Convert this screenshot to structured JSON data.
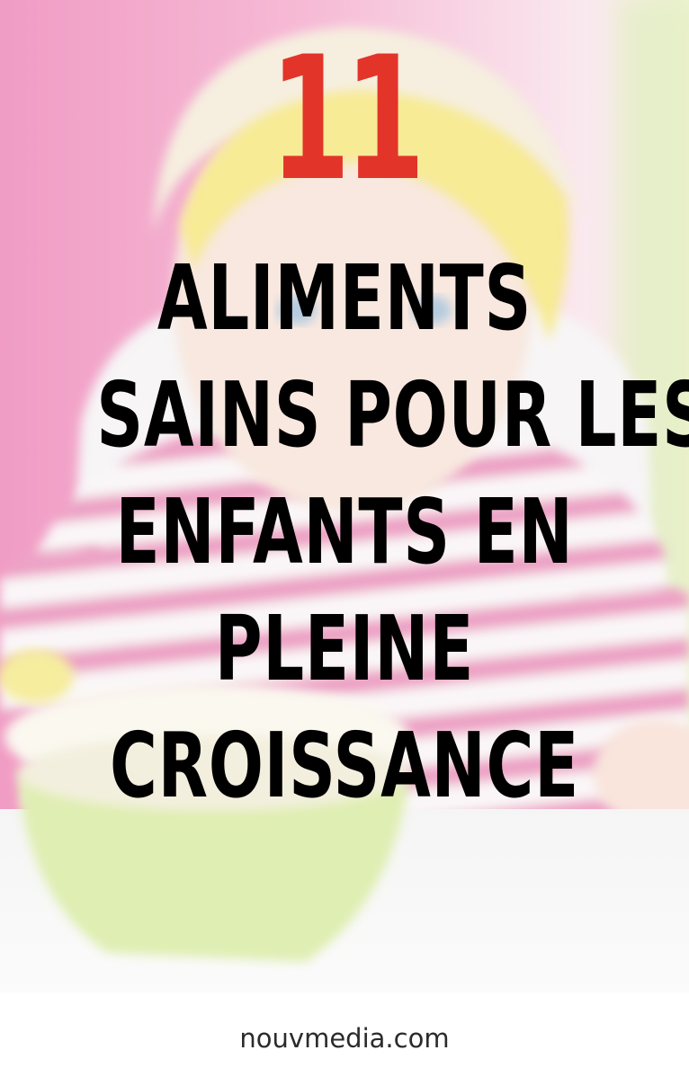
{
  "poster": {
    "number": "11",
    "title_lines": [
      "ALIMENTS",
      "SAINS POUR LES",
      "ENFANTS EN",
      "PLEINE",
      "CROISSANCE"
    ]
  },
  "footer": {
    "site": "nouvmedia.com"
  },
  "colors": {
    "number": "#e3342a",
    "title": "#000000",
    "stripe_pink": "#e0609d",
    "headband_yellow": "#f2dc4a",
    "bowl_green": "#c8e27a"
  }
}
